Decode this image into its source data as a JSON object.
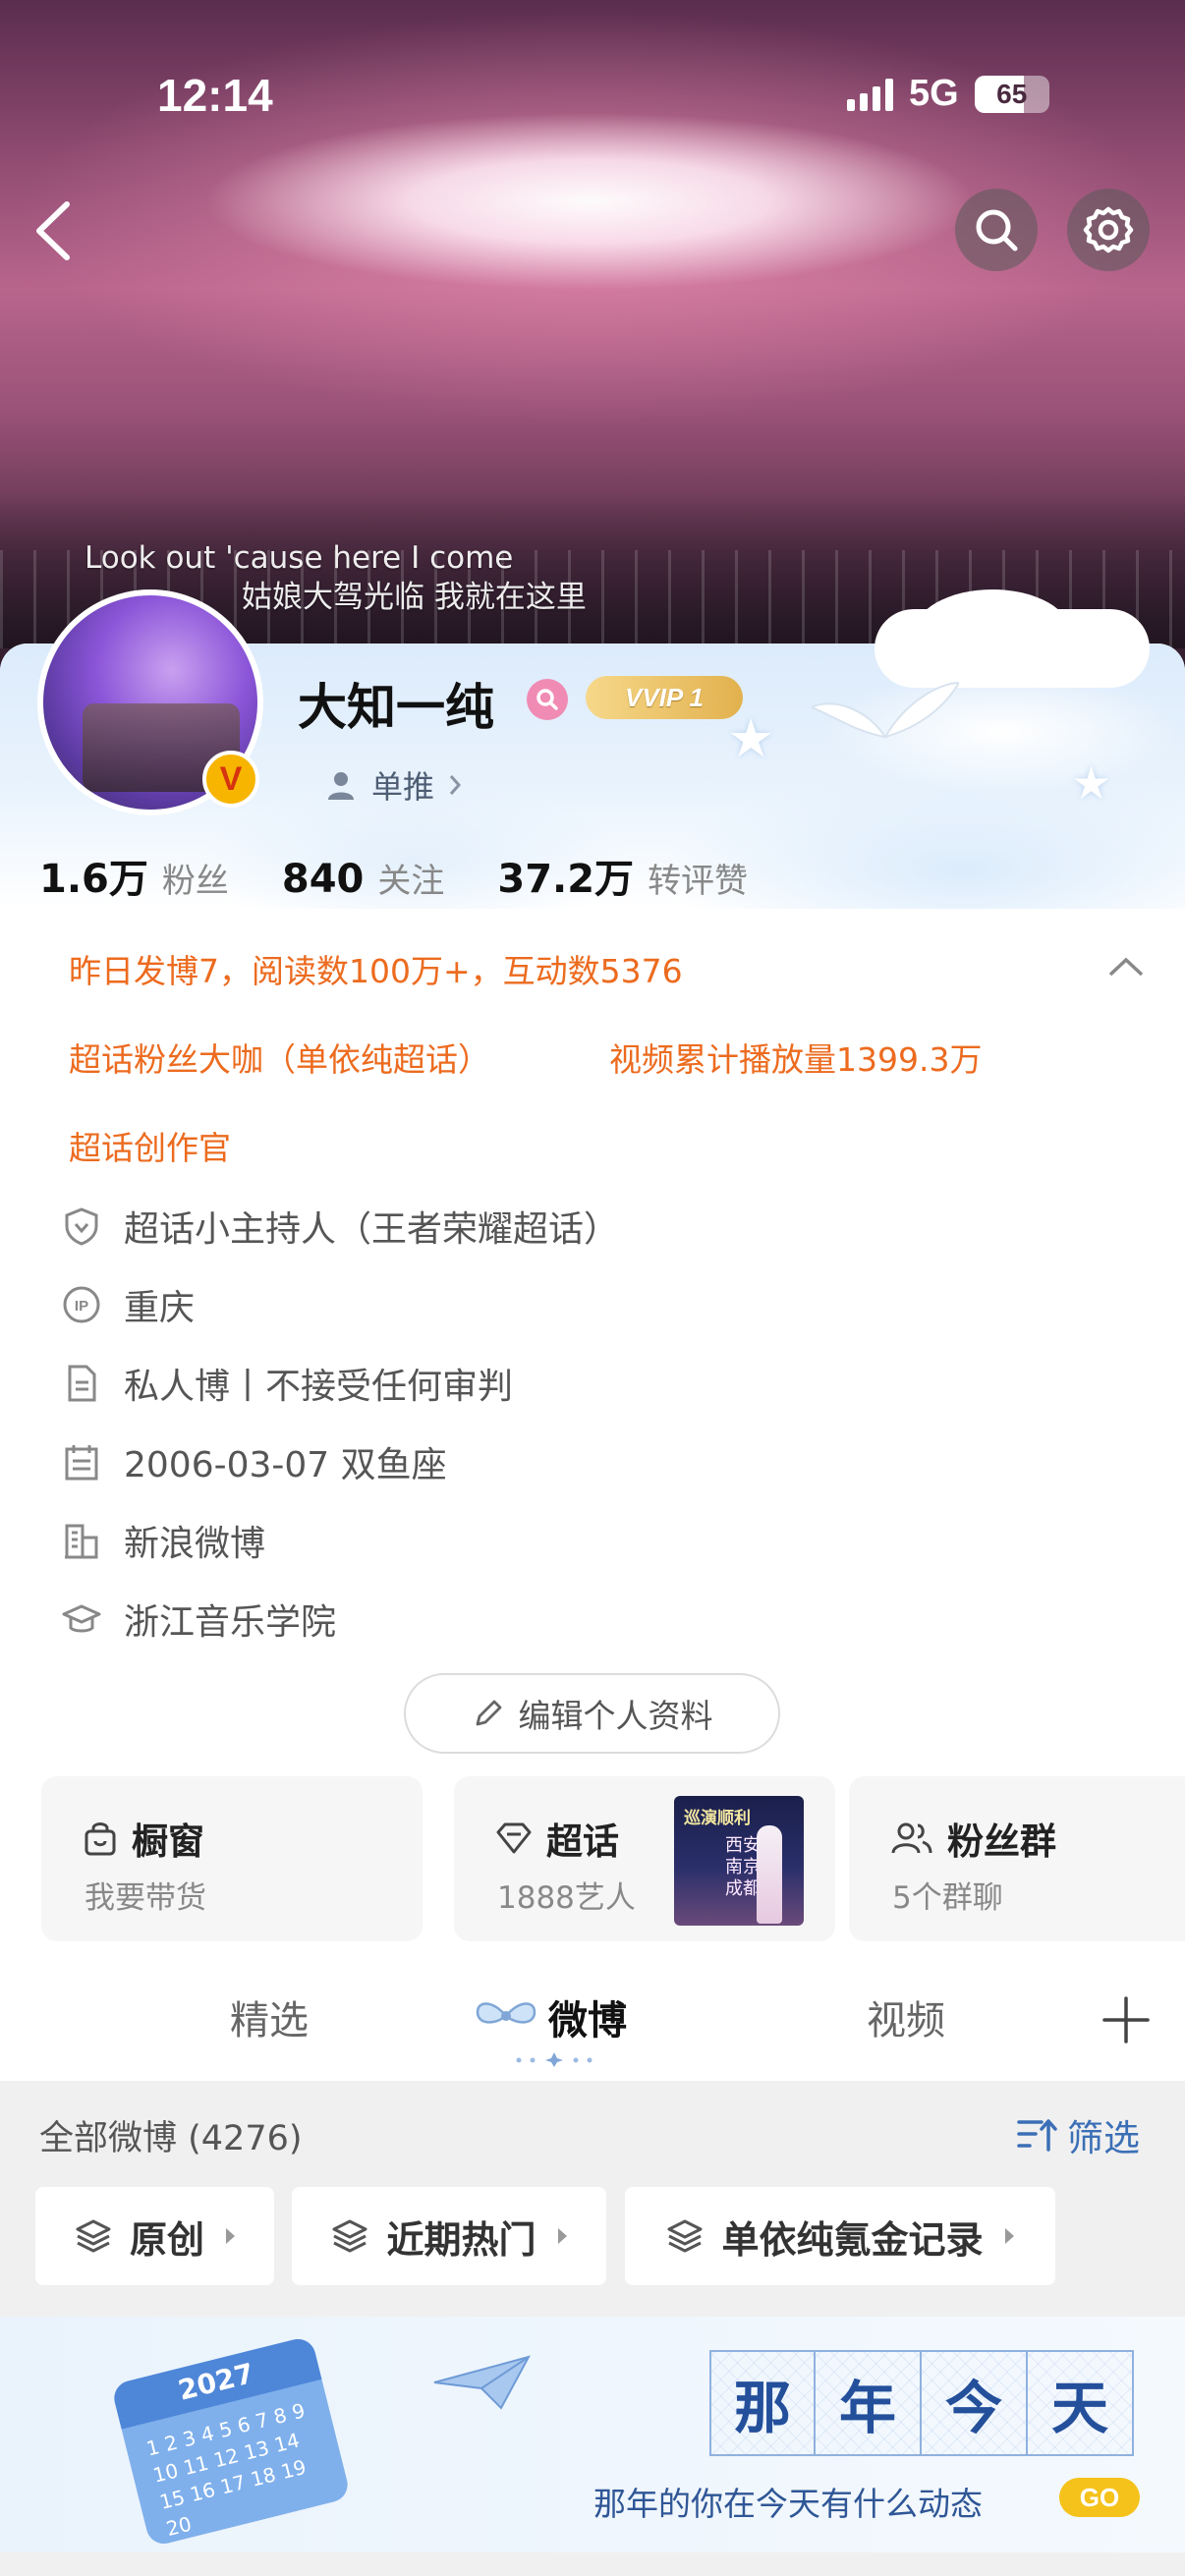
{
  "status_bar": {
    "time": "12:14",
    "network": "5G",
    "battery": "65"
  },
  "banner": {
    "lyrics_line1": "Look out 'cause here I come",
    "lyrics_line2": "姑娘大驾光临 我就在这里"
  },
  "profile": {
    "name": "大知一纯",
    "vip_badge": "VVIP 1",
    "verified_mark": "V",
    "single_push_label": "单推",
    "stats": [
      {
        "num": "1.6万",
        "label": "粉丝"
      },
      {
        "num": "840",
        "label": "关注"
      },
      {
        "num": "37.2万",
        "label": "转评赞"
      }
    ],
    "activity_summary": "昨日发博7，阅读数100万+，互动数5376",
    "honors": [
      "超话粉丝大咖（单依纯超话）",
      "视频累计播放量1399.3万",
      "超话创作官"
    ],
    "info": {
      "title": "超话小主持人（王者荣耀超话）",
      "ip_location": "重庆",
      "bio": "私人博丨不接受任何审判",
      "birthday": "2006-03-07 双鱼座",
      "company": "新浪微博",
      "school": "浙江音乐学院"
    },
    "edit_button": "编辑个人资料"
  },
  "cards": {
    "shop": {
      "title": "橱窗",
      "subtitle": "我要带货"
    },
    "super_topic": {
      "title": "超话",
      "subtitle": "1888艺人",
      "poster_title": "巡演顺利",
      "poster_cities": "西安 南京 成都"
    },
    "fan_group": {
      "title": "粉丝群",
      "subtitle": "5个群聊"
    }
  },
  "tabs": [
    "精选",
    "微博",
    "视频"
  ],
  "active_tab": "微博",
  "feed": {
    "all_label": "全部微博 (4276)",
    "filter_label": "筛选",
    "chips": [
      "原创",
      "近期热门",
      "单依纯氪金记录"
    ]
  },
  "promo": {
    "calendar_year": "2027",
    "calendar_days": "1 2 3 4 5 6 7 8 9 10 11 12 13 14 15 16 17 18 19 20",
    "chars": [
      "那",
      "年",
      "今",
      "天"
    ],
    "tagline": "那年的你在今天有什么动态",
    "go_label": "GO"
  },
  "colors": {
    "accent_orange": "#ec6b1f",
    "link_blue": "#3b6fb6",
    "vip_gold": "#e2b14e",
    "go_yellow": "#f5c21b"
  }
}
